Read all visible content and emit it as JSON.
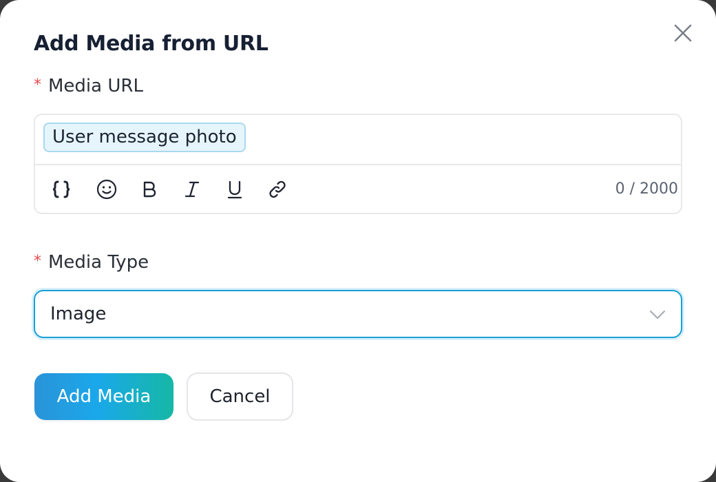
{
  "dialog": {
    "title": "Add Media from URL",
    "close_icon": "close-icon"
  },
  "media_url": {
    "required_mark": "*",
    "label": "Media URL",
    "variable_chip": "User message photo",
    "counter": "0 / 2000",
    "toolbar": [
      "variable-braces-icon",
      "emoji-icon",
      "bold-icon",
      "italic-icon",
      "underline-icon",
      "link-icon"
    ]
  },
  "media_type": {
    "required_mark": "*",
    "label": "Media Type",
    "selected": "Image"
  },
  "actions": {
    "primary_label": "Add Media",
    "cancel_label": "Cancel"
  },
  "colors": {
    "accent": "#1a9ed4",
    "required": "#e5484d",
    "chip_bg": "#e6f5fc"
  }
}
